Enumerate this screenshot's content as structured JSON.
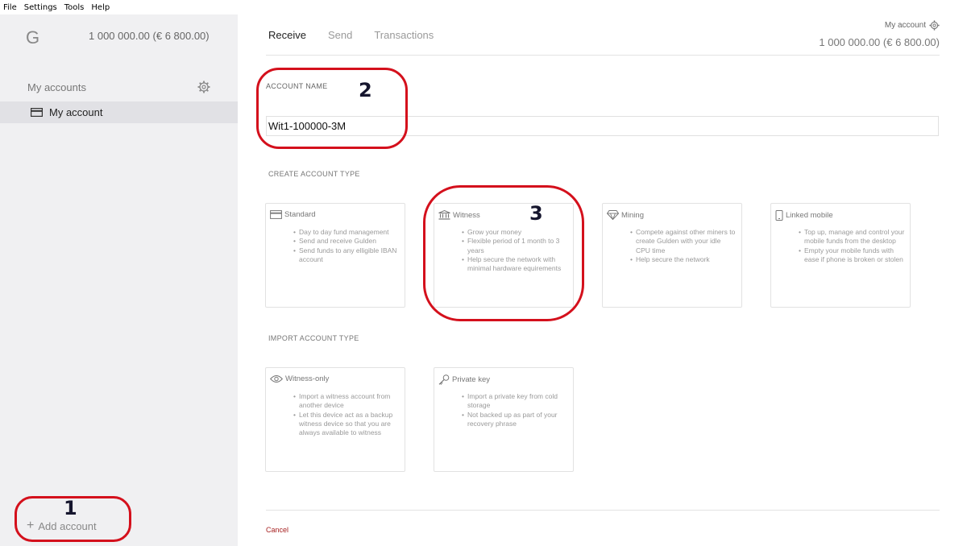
{
  "menu": [
    "File",
    "Settings",
    "Tools",
    "Help"
  ],
  "sidebar": {
    "logo": "G",
    "balance": "1 000 000.00 (€ 6 800.00)",
    "accounts_header": "My accounts",
    "accounts": [
      {
        "label": "My account"
      }
    ],
    "add_account": "Add account"
  },
  "header": {
    "tabs": [
      {
        "label": "Receive",
        "active": true
      },
      {
        "label": "Send",
        "active": false
      },
      {
        "label": "Transactions",
        "active": false
      }
    ],
    "account_label": "My account",
    "balance": "1 000 000.00 (€ 6 800.00)"
  },
  "form": {
    "account_name_label": "ACCOUNT NAME",
    "account_name_value": "Wit1-100000-3M",
    "create_type_label": "CREATE ACCOUNT TYPE",
    "import_type_label": "IMPORT ACCOUNT TYPE",
    "create_types": [
      {
        "title": "Standard",
        "icon": "card-icon",
        "bullets": [
          "Day to day fund management",
          "Send and receive Gulden",
          "Send funds to any elligible IBAN account"
        ]
      },
      {
        "title": "Witness",
        "icon": "bank-icon",
        "bullets": [
          "Grow your money",
          "Flexible period of 1 month to 3 years",
          "Help secure the network with minimal hardware equirements"
        ]
      },
      {
        "title": "Mining",
        "icon": "diamond-icon",
        "bullets": [
          "Compete against other miners to create Gulden with your idle CPU time",
          "Help secure the network"
        ]
      },
      {
        "title": "Linked mobile",
        "icon": "mobile-icon",
        "bullets": [
          "Top up, manage and control your mobile funds from the desktop",
          "Empty your mobile funds with ease if phone is broken or stolen"
        ]
      }
    ],
    "import_types": [
      {
        "title": "Witness-only",
        "icon": "eye-icon",
        "bullets": [
          "Import a witness account from another device",
          "Let this device act as a backup witness device so that you are always available to witness"
        ]
      },
      {
        "title": "Private key",
        "icon": "key-icon",
        "bullets": [
          "Import a private key from cold storage",
          "Not backed up as part of your recovery phrase"
        ]
      }
    ],
    "cancel_label": "Cancel"
  },
  "annotations": [
    "1",
    "2",
    "3"
  ],
  "colors": {
    "annotation": "#d4101c",
    "sidebar_bg": "#f0f0f2",
    "cancel": "#a62020"
  }
}
